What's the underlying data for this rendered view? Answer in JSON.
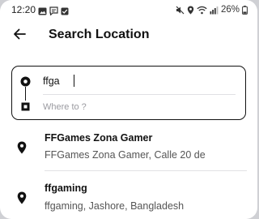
{
  "status_bar": {
    "time": "12:20",
    "left_icons": [
      "image-icon",
      "message-icon",
      "check-box-icon"
    ],
    "right_icons": [
      "mute-icon",
      "location-icon",
      "wifi-icon",
      "signal-icon",
      "battery-icon"
    ],
    "battery": "26%"
  },
  "header": {
    "back_icon": "arrow-left-icon",
    "title": "Search Location"
  },
  "route": {
    "origin_value": "ffga",
    "destination_placeholder": "Where to ?"
  },
  "results": [
    {
      "title": "FFGames Zona Gamer",
      "subtitle": "FFGames Zona Gamer, Calle 20 de",
      "icon": "location-pin-icon"
    },
    {
      "title": "ffgaming",
      "subtitle": "ffgaming, Jashore, Bangladesh",
      "icon": "location-pin-icon"
    }
  ],
  "colors": {
    "background": "#ffffff",
    "text": "#111111",
    "secondary_text": "#555555",
    "divider": "#e1e1e4"
  }
}
